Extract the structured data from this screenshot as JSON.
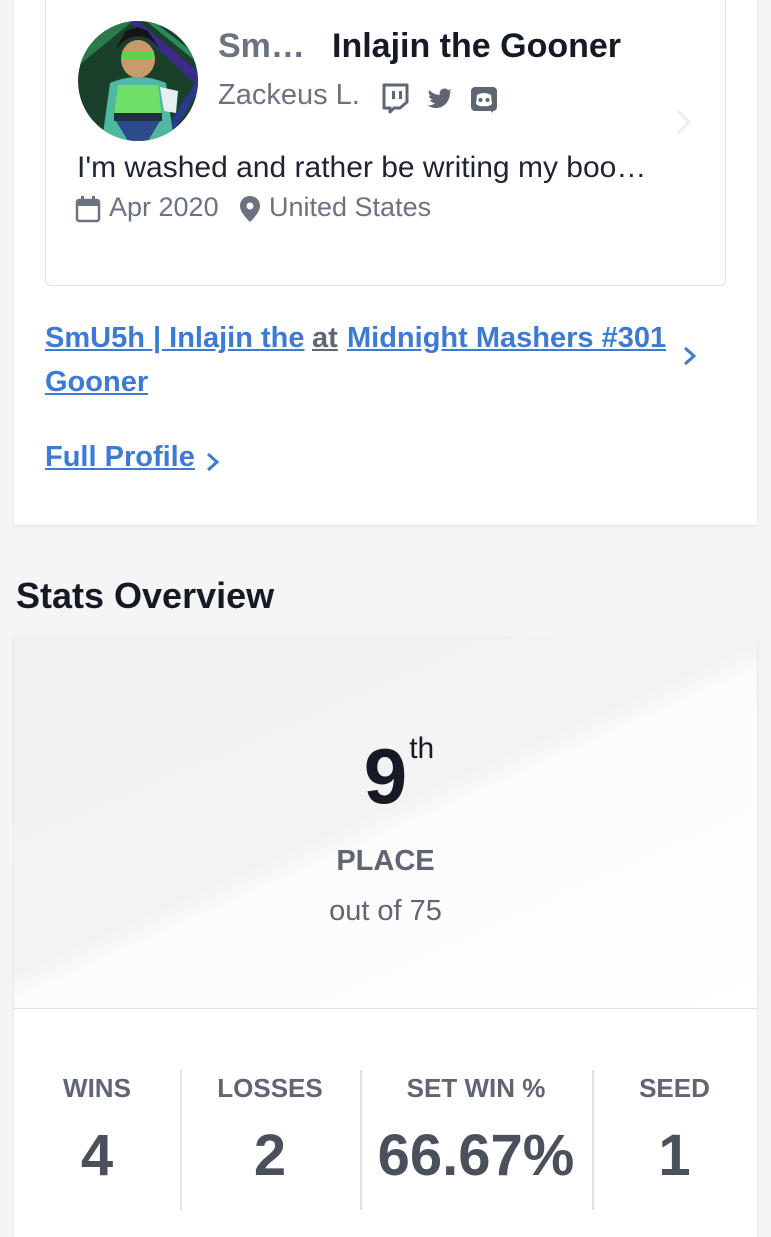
{
  "profile": {
    "prefix": "Sm…",
    "gamertag": "Inlajin the Gooner",
    "real_name": "Zackeus L.",
    "social_icons": [
      "twitch-icon",
      "twitter-icon",
      "discord-icon"
    ],
    "bio": "I'm washed and rather be writing my boo…",
    "join_date": "Apr 2020",
    "location": "United States"
  },
  "entrant": {
    "name_line1": "SmU5h | Inlajin the",
    "name_line2": "Gooner",
    "at": "at",
    "tournament": "Midnight Mashers #301"
  },
  "full_profile_label": "Full Profile",
  "stats": {
    "section_title": "Stats Overview",
    "placement": {
      "number": "9",
      "suffix": "th",
      "label": "PLACE",
      "out_of": "out of 75"
    },
    "columns": [
      {
        "label": "WINS",
        "value": "4"
      },
      {
        "label": "LOSSES",
        "value": "2"
      },
      {
        "label": "SET WIN %",
        "value": "66.67%"
      },
      {
        "label": "SEED",
        "value": "1"
      }
    ]
  },
  "colors": {
    "link": "#3c7bd1",
    "muted": "#6b7280",
    "heading": "#151a24"
  }
}
